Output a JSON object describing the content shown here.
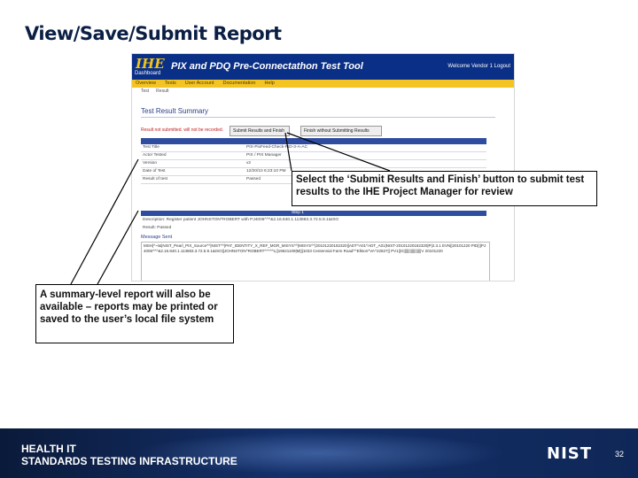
{
  "slide": {
    "title": "View/Save/Submit Report"
  },
  "screenshot": {
    "logo": "IHE",
    "logo_sub": "Dashboard",
    "tool_title": "PIX and PDQ Pre-Connectathon Test Tool",
    "welcome": "Welcome Vendor 1 Logout",
    "nav": [
      "Overview",
      "Tests",
      "User Account",
      "Documentation",
      "Help"
    ],
    "subnav": [
      "Test",
      "Result"
    ],
    "summary_heading": "Test Result Summary",
    "red_note": "Result not submitted. will not be recorded.",
    "submit_button": "Submit Results and Finish",
    "nosubmit_button": "Finish without Submitting Results",
    "rows": [
      {
        "key": "Test Title",
        "value": "PIX-PixFeed-Check-PID-3-A-AC"
      },
      {
        "key": "Actor Tested",
        "value": "PIX / PIX Manager"
      },
      {
        "key": "Version",
        "value": "v2"
      },
      {
        "key": "Date of Test",
        "value": "12/20/10 6:23:10 PM"
      },
      {
        "key": "Result of test",
        "value": "Passed"
      }
    ],
    "band_label": "Step 1",
    "description": "Description: Register patient JOHNSTON^ROBERT with PJ4006^^^&2.16.840.1.113883.3.72.5.9.1&ISO",
    "result_line": "Result: Passed",
    "message_label": "Message Sent",
    "message_text": "MSH|^~\\&|NIST_Pearl_PIX_Source^^|NIST^^|PAT_IDENTITY_X_REF_MGR_MISYS^^|MISYS^^|20101220182320||ADT^A01^ADT_A01|NIST-20101220182320|P|2.3.1 EVN||20101220 PID|||PJ4006^^^&2.16.840.1.113883.3.72.5.9.1&ISO||JOHNSTON^ROBERT^^^^^L||19621109|M|||1033 Centennial Farm Road^^Elkton^VA^22827|| PV1||O|||||||||||||||||V 20101220"
  },
  "callouts": {
    "submit_text": "Select the ‘Submit Results and Finish’ button to submit test results to the IHE Project Manager for review",
    "summary_text": "A summary-level report will also be available – reports may be printed or saved to the user’s local file system"
  },
  "footer": {
    "org_line1": "HEALTH IT",
    "org_line2": "STANDARDS TESTING INFRASTRUCTURE",
    "logo": "NIST",
    "page_number": "32"
  }
}
